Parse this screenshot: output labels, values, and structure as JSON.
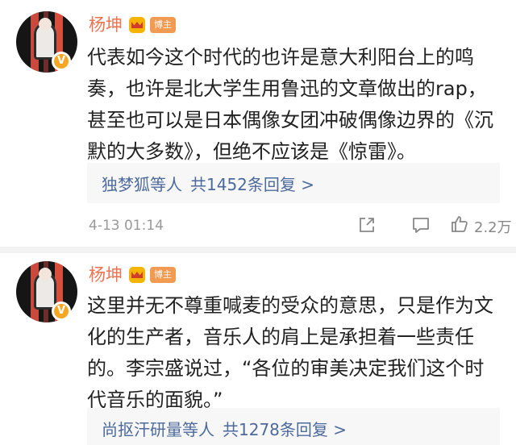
{
  "comments": [
    {
      "username": "杨坤",
      "tag": "博主",
      "text": "代表如今这个时代的也许是意大利阳台上的鸣奏，也许是北大学生用鲁迅的文章做出的rap，甚至也可以是日本偶像女团冲破偶像边界的《沉默的大多数》，但绝不应该是《惊雷》。",
      "reply_users": "独梦狐",
      "reply_suffix": "等人",
      "reply_total": "共1452条回复 >",
      "timestamp": "4-13 01:14",
      "likes": "2.2万",
      "icons": {
        "verified": "verified-v-icon",
        "crown": "crown-icon",
        "share": "share-icon",
        "comment": "comment-icon",
        "like": "like-icon"
      }
    },
    {
      "username": "杨坤",
      "tag": "博主",
      "text": "这里并无不尊重喊麦的受众的意思，只是作为文化的生产者，音乐人的肩上是承担着一些责任的。李宗盛说过，“各位的审美决定我们这个时代音乐的面貌。”",
      "reply_users": "尚抠汗研量",
      "reply_suffix": "等人",
      "reply_total": "共1278条回复 >",
      "icons": {
        "verified": "verified-v-icon",
        "crown": "crown-icon"
      }
    }
  ],
  "colors": {
    "username": "#eb7350",
    "link": "#4c6a9b",
    "meta": "#999999",
    "badge": "#f19a52",
    "verified": "#f5a623"
  },
  "badge_letter": "V"
}
